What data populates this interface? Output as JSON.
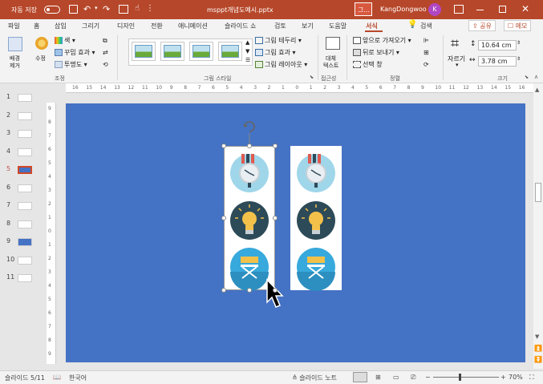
{
  "titlebar": {
    "autosave_label": "자동 저장",
    "autosave_state": "끔",
    "file_title": "msppt개념도예시.pptx",
    "search_short": "그...",
    "user_name": "KangDongwoo",
    "user_initial": "K"
  },
  "tabs": [
    "파일",
    "홈",
    "삽입",
    "그리기",
    "디자인",
    "전환",
    "애니메이션",
    "슬라이드 쇼",
    "검토",
    "보기",
    "도움말",
    "서식",
    "검색"
  ],
  "active_tab": "서식",
  "share_label": "공유",
  "comment_label": "메모",
  "ribbon": {
    "adjust": {
      "group": "조정",
      "remove_bg": [
        "배경",
        "제거"
      ],
      "corrections": "수정",
      "color": "색",
      "artistic": "꾸밈 효과",
      "transparency": "투명도"
    },
    "styles": {
      "group": "그림 스타일",
      "border": "그림 테두리",
      "effects": "그림 효과",
      "layout": "그림 레이아웃"
    },
    "accessibility": {
      "group": "접근성",
      "alt_text": [
        "대체",
        "텍스트"
      ]
    },
    "arrange": {
      "group": "정렬",
      "bring_forward": "앞으로 가져오기",
      "send_backward": "뒤로 보내기",
      "selection_pane": "선택 창"
    },
    "size": {
      "group": "크기",
      "crop": "자르기",
      "height": "10.64 cm",
      "width": "3.78 cm"
    }
  },
  "ruler_h_labels": [
    "16",
    "15",
    "14",
    "13",
    "12",
    "11",
    "10",
    "9",
    "8",
    "7",
    "6",
    "5",
    "4",
    "3",
    "2",
    "1",
    "0",
    "1",
    "2",
    "3",
    "4",
    "5",
    "6",
    "7",
    "8",
    "9",
    "10",
    "11",
    "12",
    "13",
    "14",
    "15",
    "16"
  ],
  "ruler_v_labels": [
    "9",
    "8",
    "7",
    "6",
    "5",
    "4",
    "3",
    "2",
    "1",
    "0",
    "1",
    "2",
    "3",
    "4",
    "5",
    "6",
    "7",
    "8",
    "9"
  ],
  "thumbnails": [
    {
      "num": "1",
      "style": "white"
    },
    {
      "num": "2",
      "style": "white"
    },
    {
      "num": "3",
      "style": "white"
    },
    {
      "num": "4",
      "style": "white"
    },
    {
      "num": "5",
      "style": "blue",
      "active": true
    },
    {
      "num": "6",
      "style": "white"
    },
    {
      "num": "7",
      "style": "white"
    },
    {
      "num": "8",
      "style": "white"
    },
    {
      "num": "9",
      "style": "blue"
    },
    {
      "num": "10",
      "style": "white"
    },
    {
      "num": "11",
      "style": "white"
    }
  ],
  "slide": {
    "background_color": "#4472c4",
    "icons": [
      "clock-icon",
      "lightbulb-icon",
      "director-chair-icon"
    ]
  },
  "statusbar": {
    "slide_info": "슬라이드 5/11",
    "language": "한국어",
    "notes": "슬라이드 노트",
    "zoom": "70%"
  },
  "colors": {
    "accent": "#b7472a",
    "slide_bg": "#4472c4",
    "clock_bg": "#9fd6ea",
    "bulb_bg": "#2d4a58",
    "chair_bg": "#37a9dc"
  }
}
